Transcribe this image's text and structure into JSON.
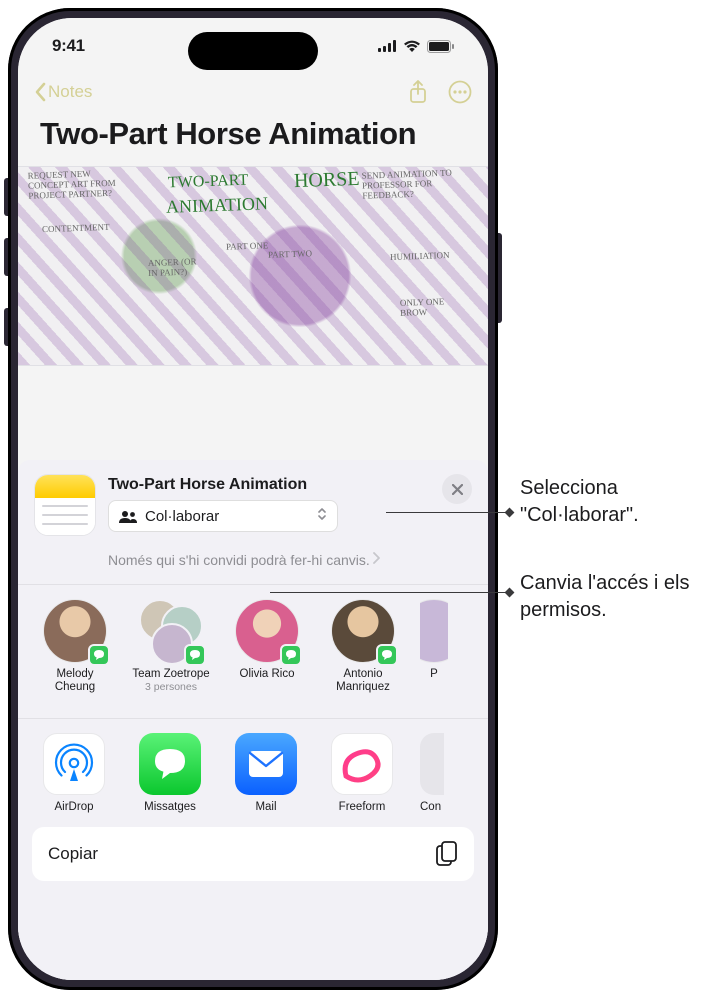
{
  "status": {
    "time": "9:41"
  },
  "nav": {
    "back_label": "Notes"
  },
  "note": {
    "title": "Two-Part Horse Animation"
  },
  "illustration_labels": {
    "a": "TWO-PART",
    "b": "ANIMATION",
    "c": "HORSE",
    "small1": "REQUEST NEW CONCEPT ART FROM PROJECT PARTNER?",
    "small2": "CONTENTMENT",
    "small3": "ANGER (OR IN PAIN?)",
    "small4": "PART ONE",
    "small5": "PART TWO",
    "small6": "SEND ANIMATION TO PROFESSOR FOR FEEDBACK?",
    "small7": "HUMILIATION",
    "small8": "ONLY ONE BROW"
  },
  "sheet": {
    "title": "Two-Part Horse Animation",
    "mode_label": "Col·laborar",
    "permissions_text": "Només qui s'hi convidi podrà fer-hi canvis."
  },
  "contacts": [
    {
      "name": "Melody Cheung"
    },
    {
      "name": "Team Zoetrope",
      "subtitle": "3 persones",
      "group": true
    },
    {
      "name": "Olivia Rico"
    },
    {
      "name": "Antonio Manriquez"
    },
    {
      "name": "P"
    }
  ],
  "apps": [
    {
      "label": "AirDrop",
      "icon": "airdrop"
    },
    {
      "label": "Missatges",
      "icon": "messages"
    },
    {
      "label": "Mail",
      "icon": "mail"
    },
    {
      "label": "Freeform",
      "icon": "freeform"
    },
    {
      "label": "Con",
      "icon": "generic"
    }
  ],
  "actions": {
    "copy": "Copiar"
  },
  "callouts": {
    "mode": "Selecciona \"Col·laborar\".",
    "perm": "Canvia l'accés i els permisos."
  }
}
